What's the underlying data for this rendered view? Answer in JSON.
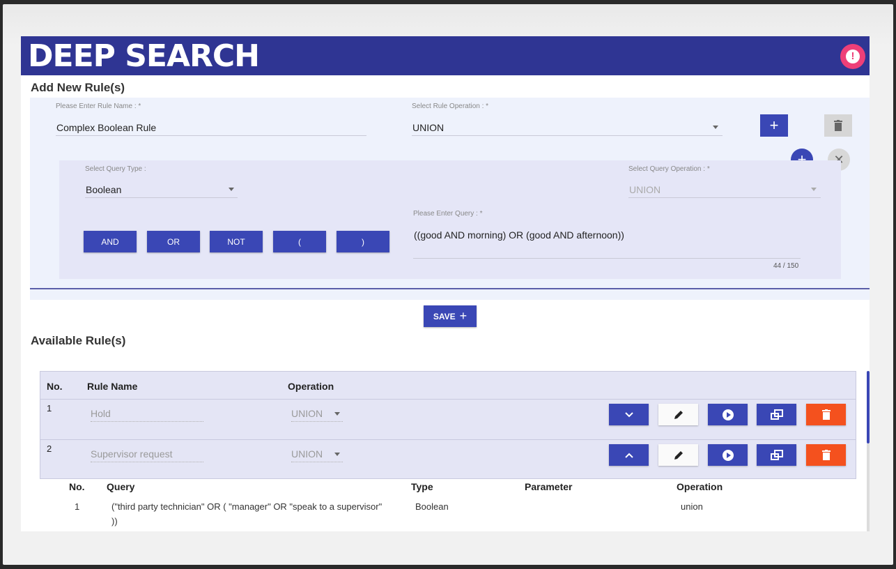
{
  "app": {
    "title": "DEEP SEARCH",
    "alert_icon": "alert-icon"
  },
  "add_rule": {
    "section_title": "Add New Rule(s)",
    "rule_name_label": "Please Enter Rule Name : *",
    "rule_name_value": "Complex Boolean Rule",
    "rule_operation_label": "Select Rule Operation : *",
    "rule_operation_value": "UNION",
    "query": {
      "type_label": "Select Query Type :",
      "type_value": "Boolean",
      "operation_label": "Select Query Operation : *",
      "operation_value": "UNION",
      "query_label": "Please Enter Query : *",
      "query_value": "((good AND morning) OR (good AND afternoon))",
      "char_count": "44 / 150",
      "operators": [
        "AND",
        "OR",
        "NOT",
        "(",
        ")"
      ]
    },
    "save_label": "SAVE"
  },
  "available": {
    "section_title": "Available Rule(s)",
    "headers": {
      "no": "No.",
      "rule_name": "Rule Name",
      "operation": "Operation"
    },
    "rows": [
      {
        "no": "1",
        "name": "Hold",
        "operation": "UNION",
        "expand_icon": "chevron-down-icon"
      },
      {
        "no": "2",
        "name": "Supervisor request",
        "operation": "UNION",
        "expand_icon": "chevron-up-icon"
      }
    ],
    "detail": {
      "headers": {
        "no": "No.",
        "query": "Query",
        "type": "Type",
        "parameter": "Parameter",
        "operation": "Operation"
      },
      "rows": [
        {
          "no": "1",
          "query_line1": "(\"third party technician\" OR ( \"manager\" OR \"speak to a supervisor\"",
          "query_line2": "))",
          "type": "Boolean",
          "parameter": "",
          "operation": "union"
        }
      ]
    }
  },
  "colors": {
    "primary": "#3a47b5",
    "header": "#2f3593",
    "danger": "#f4511e",
    "alert": "#ee3f78"
  }
}
